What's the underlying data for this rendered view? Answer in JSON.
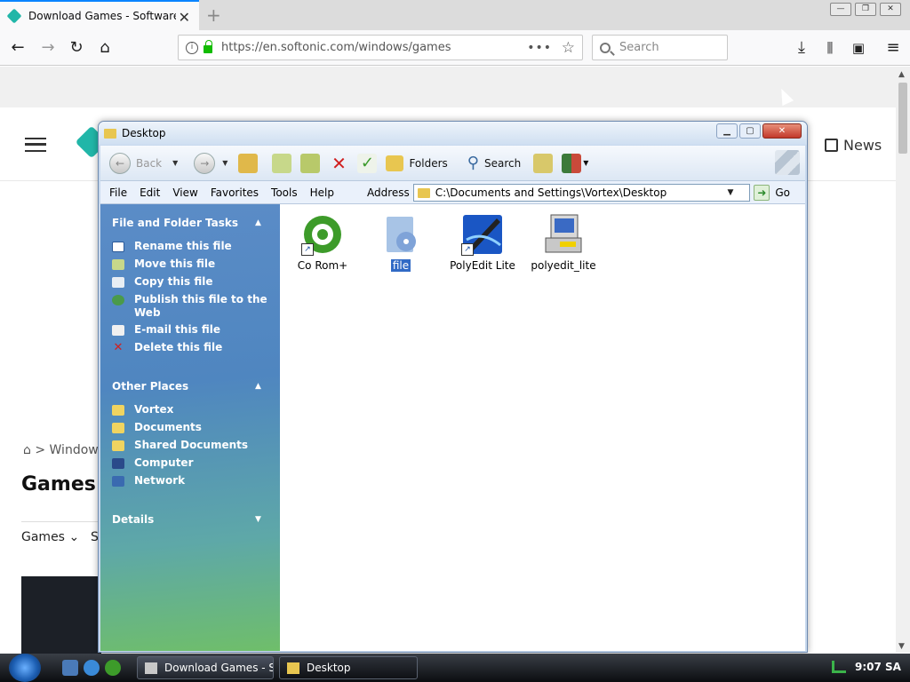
{
  "browser": {
    "tab_title": "Download Games - Software fo",
    "new_tab": "+",
    "url": "https://en.softonic.com/windows/games",
    "url_more": "•••",
    "search_placeholder": "Search"
  },
  "page": {
    "news_label": "News",
    "breadcrumb": "> Window",
    "heading": "Games f",
    "menu_games": "Games",
    "menu_second": "S"
  },
  "explorer": {
    "title": "Desktop",
    "toolbar": {
      "back": "Back",
      "folders": "Folders",
      "search": "Search"
    },
    "menu": [
      "File",
      "Edit",
      "View",
      "Favorites",
      "Tools",
      "Help"
    ],
    "address_label": "Address",
    "address_value": "C:\\Documents and Settings\\Vortex\\Desktop",
    "go_label": "Go",
    "file_tasks": {
      "title": "File and Folder Tasks",
      "items": [
        "Rename this file",
        "Move this file",
        "Copy this file",
        "Publish this file to the Web",
        "E-mail this file",
        "Delete this file"
      ]
    },
    "other_places": {
      "title": "Other Places",
      "items": [
        "Vortex",
        "Documents",
        "Shared Documents",
        "Computer",
        "Network"
      ]
    },
    "details": {
      "title": "Details"
    },
    "files": [
      "Co Rom+",
      "file",
      "PolyEdit Lite",
      "polyedit_lite"
    ],
    "selected_file": "file"
  },
  "taskbar": {
    "items": [
      "Download Games - S...",
      "Desktop"
    ],
    "active_item": "Desktop",
    "clock": "9:07 SA"
  },
  "colors": {
    "accent_tab": "#0a84ff",
    "lock_green": "#12bc00",
    "softonic_teal": "#21b6a8",
    "selection_blue": "#316ac5",
    "task_pane_blue": "#4f86c0"
  }
}
